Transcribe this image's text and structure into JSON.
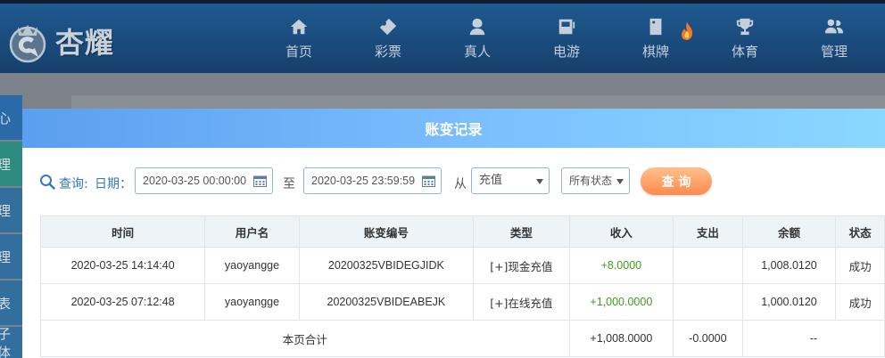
{
  "brand": {
    "name": "杏耀"
  },
  "nav": [
    {
      "label": "首页",
      "icon": "home-icon"
    },
    {
      "label": "彩票",
      "icon": "lottery-ticket-icon"
    },
    {
      "label": "真人",
      "icon": "live-dealer-icon"
    },
    {
      "label": "电游",
      "icon": "slot-machine-icon"
    },
    {
      "label": "棋牌",
      "icon": "card-game-icon"
    },
    {
      "label": "体育",
      "icon": "trophy-icon"
    },
    {
      "label": "管理",
      "icon": "users-icon"
    }
  ],
  "sidebar": {
    "items": [
      "心",
      "理",
      "理",
      "理",
      "表",
      "子体"
    ]
  },
  "modal": {
    "title": "账变记录",
    "query_label": "查询:",
    "date_label": "日期：",
    "date_start": "2020-03-25 00:00:00",
    "to_label": "至",
    "date_end": "2020-03-25 23:59:59",
    "from_label": "从",
    "type_select": "充值",
    "status_select": "所有状态",
    "query_button": "查 询"
  },
  "table": {
    "headers": [
      "时间",
      "用户名",
      "账变编号",
      "类型",
      "收入",
      "支出",
      "余额",
      "状态"
    ],
    "rows": [
      {
        "time": "2020-03-25 14:14:40",
        "user": "yaoyangge",
        "id": "20200325VBIDEGJIDK",
        "type": "[+]现金充值",
        "income": "+8.0000",
        "expense": "",
        "balance": "1,008.0120",
        "status": "成功"
      },
      {
        "time": "2020-03-25 07:12:48",
        "user": "yaoyangge",
        "id": "20200325VBIDEABEJK",
        "type": "[+]在线充值",
        "income": "+1,000.0000",
        "expense": "",
        "balance": "1,000.0120",
        "status": "成功"
      }
    ],
    "summary": {
      "label": "本页合计",
      "income": "+1,008.0000",
      "expense": "-0.0000",
      "balance": "--"
    }
  },
  "colors": {
    "header_bar": "#1f5a90",
    "modal_header": "#7cc0ff",
    "query_button": "#ff8a4c",
    "income_text": "#3e9b1d",
    "label_blue": "#3679b8"
  }
}
